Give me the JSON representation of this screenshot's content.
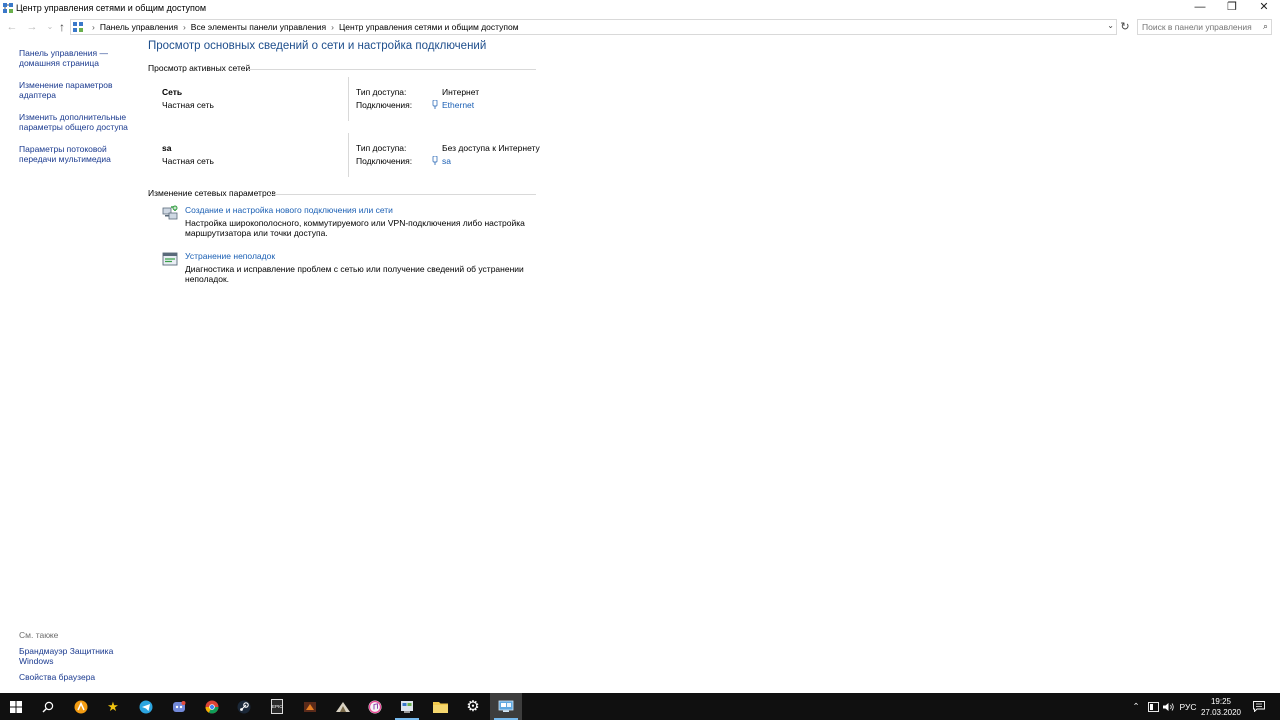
{
  "window": {
    "title": "Центр управления сетями и общим доступом",
    "minimize": "—",
    "maximize": "❐",
    "close": "✕"
  },
  "address": {
    "crumbs": [
      "Панель управления",
      "Все элементы панели управления",
      "Центр управления сетями и общим доступом"
    ],
    "search_placeholder": "Поиск в панели управления"
  },
  "sidebar": {
    "links": [
      "Панель управления — домашняя страница",
      "Изменение параметров адаптера",
      "Изменить дополнительные параметры общего доступа",
      "Параметры потоковой передачи мультимедиа"
    ],
    "see_also_header": "См. также",
    "see_also": [
      "Брандмауэр Защитника Windows",
      "Свойства браузера"
    ]
  },
  "main": {
    "title": "Просмотр основных сведений о сети и настройка подключений",
    "active_networks_header": "Просмотр активных сетей",
    "networks": [
      {
        "name": "Сеть",
        "type": "Частная сеть",
        "access_label": "Тип доступа:",
        "access_value": "Интернет",
        "connections_label": "Подключения:",
        "connection": "Ethernet"
      },
      {
        "name": "sa",
        "type": "Частная сеть",
        "access_label": "Тип доступа:",
        "access_value": "Без доступа к Интернету",
        "connections_label": "Подключения:",
        "connection": "sa"
      }
    ],
    "change_settings_header": "Изменение сетевых параметров",
    "tasks": [
      {
        "link": "Создание и настройка нового подключения или сети",
        "desc": "Настройка широкополосного, коммутируемого или VPN-подключения либо настройка маршрутизатора или точки доступа."
      },
      {
        "link": "Устранение неполадок",
        "desc": "Диагностика и исправление проблем с сетью или получение сведений об устранении неполадок."
      }
    ]
  },
  "taskbar": {
    "apps": [
      "start-icon",
      "search-icon",
      "avast-icon",
      "star-app-icon",
      "telegram-icon",
      "discord-icon",
      "chrome-icon",
      "steam-icon",
      "epic-games-icon",
      "app-orange-icon",
      "app-game-icon",
      "itunes-icon",
      "control-panel-icon",
      "file-explorer-icon",
      "settings-icon",
      "network-center-icon"
    ],
    "epic_label": "EPIC",
    "language": "РУС",
    "time": "19:25",
    "date": "27.03.2020",
    "accent": "#76b9ed"
  },
  "colors": {
    "link": "#1a5fb4",
    "title": "#1e4e8c",
    "sidebar_link": "#1a3a8f",
    "taskbar": "#101010"
  }
}
